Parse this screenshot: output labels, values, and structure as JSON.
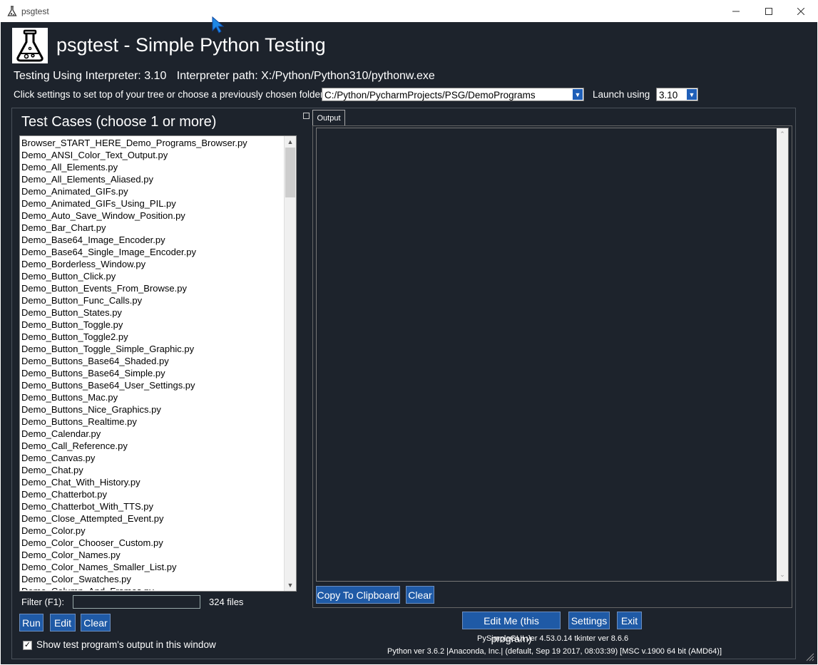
{
  "window": {
    "title": "psgtest"
  },
  "header": {
    "title": "psgtest - Simple Python Testing"
  },
  "info": {
    "interpreter_label": "Testing Using Interpreter: 3.10",
    "path_label": "Interpreter path: X:/Python/Python310/pythonw.exe"
  },
  "settings": {
    "prompt": "Click settings to set top of your tree or choose a previously chosen folder",
    "folder_value": "C:/Python/PycharmProjects/PSG/DemoPrograms",
    "launch_label": "Launch using",
    "launch_value": "3.10"
  },
  "testcases": {
    "title": "Test Cases (choose 1 or more)",
    "items": [
      "Browser_START_HERE_Demo_Programs_Browser.py",
      "Demo_ANSI_Color_Text_Output.py",
      "Demo_All_Elements.py",
      "Demo_All_Elements_Aliased.py",
      "Demo_Animated_GIFs.py",
      "Demo_Animated_GIFs_Using_PIL.py",
      "Demo_Auto_Save_Window_Position.py",
      "Demo_Bar_Chart.py",
      "Demo_Base64_Image_Encoder.py",
      "Demo_Base64_Single_Image_Encoder.py",
      "Demo_Borderless_Window.py",
      "Demo_Button_Click.py",
      "Demo_Button_Events_From_Browse.py",
      "Demo_Button_Func_Calls.py",
      "Demo_Button_States.py",
      "Demo_Button_Toggle.py",
      "Demo_Button_Toggle2.py",
      "Demo_Button_Toggle_Simple_Graphic.py",
      "Demo_Buttons_Base64_Shaded.py",
      "Demo_Buttons_Base64_Simple.py",
      "Demo_Buttons_Base64_User_Settings.py",
      "Demo_Buttons_Mac.py",
      "Demo_Buttons_Nice_Graphics.py",
      "Demo_Buttons_Realtime.py",
      "Demo_Calendar.py",
      "Demo_Call_Reference.py",
      "Demo_Canvas.py",
      "Demo_Chat.py",
      "Demo_Chat_With_History.py",
      "Demo_Chatterbot.py",
      "Demo_Chatterbot_With_TTS.py",
      "Demo_Close_Attempted_Event.py",
      "Demo_Color.py",
      "Demo_Color_Chooser_Custom.py",
      "Demo_Color_Names.py",
      "Demo_Color_Names_Smaller_List.py",
      "Demo_Color_Swatches.py",
      "Demo_Column_And_Frames.py"
    ],
    "filter_label": "Filter (F1):",
    "filter_value": "",
    "count": "324 files"
  },
  "buttons": {
    "run": "Run",
    "edit": "Edit",
    "clear": "Clear",
    "copy": "Copy To Clipboard",
    "clear_output": "Clear",
    "edit_me": "Edit Me (this program)",
    "settings": "Settings",
    "exit": "Exit"
  },
  "checkbox": {
    "label": "Show test program's output in this window",
    "checked": true
  },
  "output": {
    "tab_label": "Output"
  },
  "footer": {
    "versions": "PySimpleGUI ver 4.53.0.14  tkinter ver 8.6.6",
    "python": "Python ver 3.6.2 |Anaconda, Inc.| (default, Sep 19 2017, 08:03:39) [MSC v.1900 64 bit (AMD64)]"
  },
  "colors": {
    "background": "#1d232c",
    "button": "#1f5aa6"
  }
}
